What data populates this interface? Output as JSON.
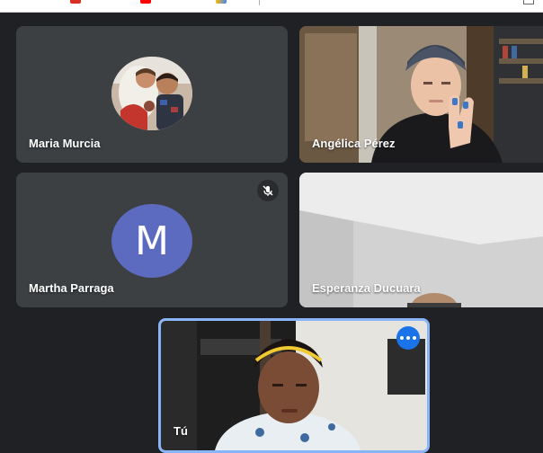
{
  "participants": [
    {
      "name": "Maria Murcia",
      "avatar": "photo",
      "muted": false
    },
    {
      "name": "Angélica Pérez",
      "avatar": "video",
      "muted": false
    },
    {
      "name": "Martha Parraga",
      "avatar": "letter",
      "initial": "M",
      "muted": true
    },
    {
      "name": "Esperanza Ducuara",
      "avatar": "video",
      "muted": false
    }
  ],
  "self": {
    "name": "Tú",
    "pinned_highlight": true
  },
  "icons": {
    "mute": "mic-off-icon",
    "more": "more-options-icon"
  },
  "colors": {
    "background": "#202124",
    "tile": "#3c4043",
    "avatar_letter_bg": "#5c6bc0",
    "self_border": "#8ab4f8",
    "more_button": "#1a73e8"
  }
}
